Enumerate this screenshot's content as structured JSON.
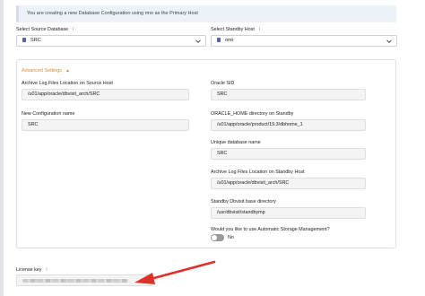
{
  "banner": {
    "text": "You are creating a new Database Configuration using rmo as the Primary Host"
  },
  "source_db": {
    "label": "Select Source Database",
    "info": "i",
    "value": "SRC"
  },
  "standby_host": {
    "label": "Select Standby Host",
    "info": "i",
    "value": "ono"
  },
  "advanced": {
    "toggle_label": "Advanced Settings",
    "caret": "▲",
    "fields": {
      "archive_source": {
        "label": "Archive Log Files Location on Source Host",
        "value": "/u01/app/oracle/dbvisit_arch/SRC"
      },
      "new_config_name": {
        "label": "New Configuration name",
        "value": "SRC"
      },
      "oracle_sid": {
        "label": "Oracle SID",
        "value": "SRC"
      },
      "oracle_home": {
        "label": "ORACLE_HOME directory on Standby",
        "value": "/u01/app/oracle/product/19.3/dbhome_1"
      },
      "unique_db_name": {
        "label": "Unique database name",
        "value": "SRC"
      },
      "archive_standby": {
        "label": "Archive Log Files Location on Standby Host",
        "value": "/u01/app/oracle/dbvisit_arch/SRC"
      },
      "standby_base": {
        "label": "Standby Dbvisit base directory",
        "value": "/usr/dbvisit/standbymp"
      },
      "asm": {
        "label": "Would you like to use Automatic Storage Management?",
        "value": "No"
      }
    }
  },
  "license": {
    "label": "License key",
    "info": "i"
  },
  "colors": {
    "accent": "#e58a2c",
    "arrow": "#e0302a",
    "icon": "#5a5fa8"
  },
  "icons": {
    "db": "database-icon",
    "chevron": "chevron-down-icon"
  }
}
